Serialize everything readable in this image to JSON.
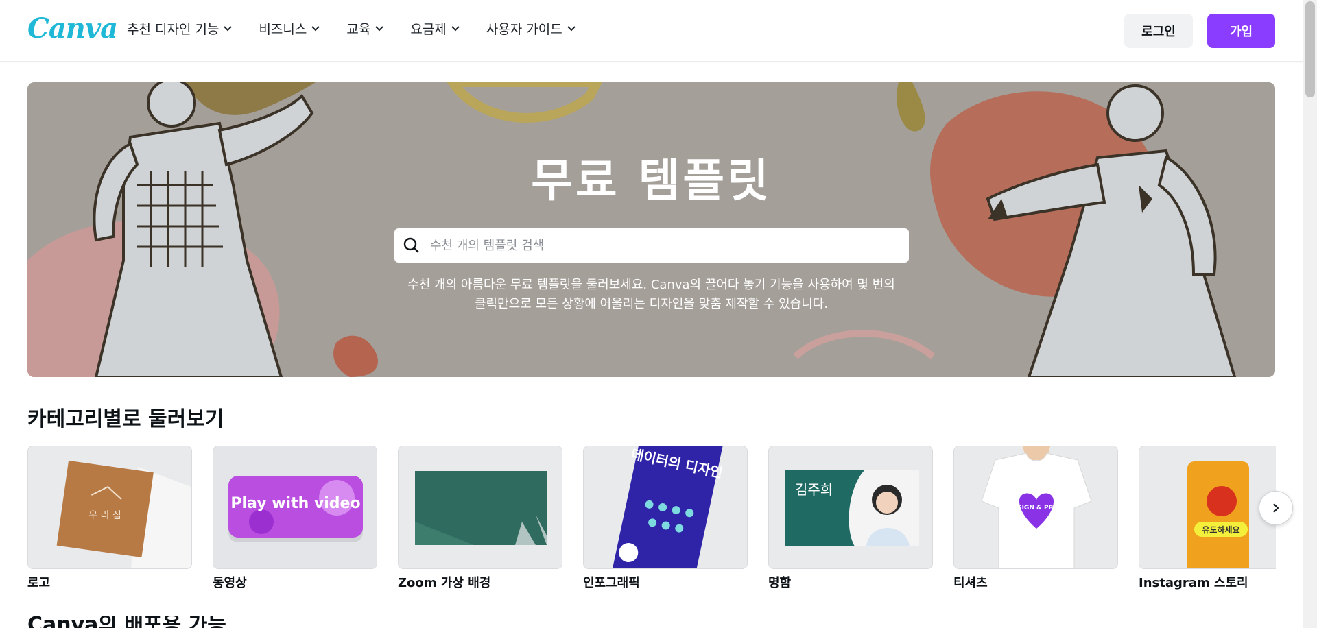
{
  "header": {
    "logo": "Canva",
    "nav": [
      {
        "label": "추천 디자인 기능"
      },
      {
        "label": "비즈니스"
      },
      {
        "label": "교육"
      },
      {
        "label": "요금제"
      },
      {
        "label": "사용자 가이드"
      }
    ],
    "login_label": "로그인",
    "signup_label": "가입"
  },
  "hero": {
    "title": "무료 템플릿",
    "search_placeholder": "수천 개의 템플릿 검색",
    "desc_line1": "수천 개의 아름다운 무료 템플릿을 둘러보세요. Canva의 끌어다 놓기 기능을 사용하여 몇 번의",
    "desc_line2": "클릭만으로 모든 상황에 어울리는 디자인을 맞춤 제작할 수 있습니다."
  },
  "categories": {
    "title": "카테고리별로 둘러보기",
    "items": [
      {
        "label": "로고",
        "thumb_text": "우 리 집"
      },
      {
        "label": "동영상",
        "thumb_text": "Play with video"
      },
      {
        "label": "Zoom 가상 배경",
        "thumb_text": ""
      },
      {
        "label": "인포그래픽",
        "thumb_text": "데이터의 디자인"
      },
      {
        "label": "명함",
        "thumb_text": "김주희"
      },
      {
        "label": "티셔츠",
        "thumb_text": "DESIGN & PRINT"
      },
      {
        "label": "Instagram 스토리",
        "thumb_text": "유도하세요"
      }
    ]
  },
  "next_section_title": "Canva의 배포용 가능",
  "colors": {
    "accent": "#8b3dff",
    "logo": "#1fb8d6"
  }
}
